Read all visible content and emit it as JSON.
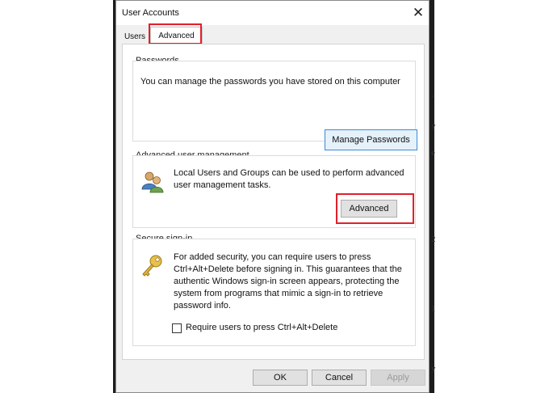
{
  "window": {
    "title": "User Accounts",
    "close_glyph": "✕"
  },
  "tabs": [
    {
      "label": "Users"
    },
    {
      "label": "Advanced"
    }
  ],
  "passwords": {
    "heading": "Passwords",
    "description": "You can manage the passwords you have stored on this computer",
    "button_label": "Manage Passwords"
  },
  "user_management": {
    "heading": "Advanced user management",
    "description_line1": "Local Users and Groups can be used to perform advanced",
    "description_line2": "user management tasks.",
    "button_label": "Advanced",
    "icon": "users-icon"
  },
  "secure_signin": {
    "heading": "Secure sign-in",
    "lines": [
      "For added security, you can require users to press",
      "Ctrl+Alt+Delete before signing in. This guarantees that the",
      "authentic Windows sign-in screen appears, protecting the",
      "system from programs that mimic a sign-in to retrieve",
      "password info."
    ],
    "checkbox_label": "Require users to press Ctrl+Alt+Delete",
    "checked": false,
    "icon": "key-icon"
  },
  "footer": {
    "ok_label": "OK",
    "cancel_label": "Cancel",
    "apply_label": "Apply"
  },
  "colors": {
    "highlight": "#e0202b",
    "dialog_bg": "#f0f0f0",
    "focus_border": "#3c8ad3"
  },
  "background_text": {
    "right_fragments": [
      ",",
      "y",
      "e",
      "2",
      "1",
      "y"
    ]
  }
}
